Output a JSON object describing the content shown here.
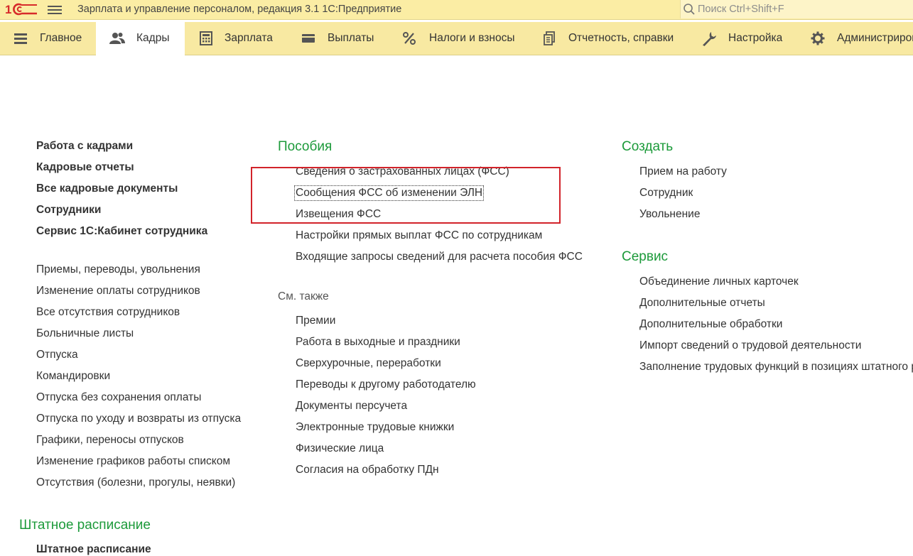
{
  "titlebar": {
    "app_title": "Зарплата и управление персоналом, редакция 3.1 1С:Предприятие",
    "search_placeholder": "Поиск Ctrl+Shift+F"
  },
  "sections": [
    {
      "label": "Главное",
      "icon": "menu-lines-icon"
    },
    {
      "label": "Кадры",
      "icon": "people-icon",
      "active": true
    },
    {
      "label": "Зарплата",
      "icon": "calculator-icon"
    },
    {
      "label": "Выплаты",
      "icon": "wallet-icon"
    },
    {
      "label": "Налоги и взносы",
      "icon": "percent-icon"
    },
    {
      "label": "Отчетность, справки",
      "icon": "documents-icon"
    },
    {
      "label": "Настройка",
      "icon": "wrench-icon"
    },
    {
      "label": "Администрирование",
      "icon": "gear-icon"
    }
  ],
  "left_column": {
    "main_links": [
      "Работа с кадрами",
      "Кадровые отчеты",
      "Все кадровые документы",
      "Сотрудники",
      "Сервис 1С:Кабинет сотрудника"
    ],
    "links": [
      "Приемы, переводы, увольнения",
      "Изменение оплаты сотрудников",
      "Все отсутствия сотрудников",
      "Больничные листы",
      "Отпуска",
      "Командировки",
      "Отпуска без сохранения оплаты",
      "Отпуска по уходу и возвраты из отпуска",
      "Графики, переносы отпусков",
      "Изменение графиков работы списком",
      "Отсутствия (болезни, прогулы, неявки)"
    ],
    "staffing_title": "Штатное расписание",
    "staffing_links": [
      "Штатное расписание"
    ]
  },
  "middle_column": {
    "benefits_title": "Пособия",
    "benefits_links": [
      "Сведения о застрахованных лицах (ФСС)",
      "Сообщения ФСС об изменении ЭЛН",
      "Извещения ФСС",
      "Настройки прямых выплат ФСС по сотрудникам",
      "Входящие запросы сведений для расчета пособия ФСС"
    ],
    "see_also_title": "См. также",
    "see_also_links": [
      "Премии",
      "Работа в выходные и праздники",
      "Сверхурочные, переработки",
      "Переводы к другому работодателю",
      "Документы персучета",
      "Электронные трудовые книжки",
      "Физические лица",
      "Согласия на обработку ПДн"
    ]
  },
  "right_column": {
    "create_title": "Создать",
    "create_links": [
      "Прием на работу",
      "Сотрудник",
      "Увольнение"
    ],
    "service_title": "Сервис",
    "service_links": [
      "Объединение личных карточек",
      "Дополнительные отчеты",
      "Дополнительные обработки",
      "Импорт сведений о трудовой деятельности",
      "Заполнение трудовых функций в позициях штатного р"
    ]
  },
  "colors": {
    "titlebar_bg": "#fbeda4",
    "tabsbar_bg": "#f8e9a2",
    "group_title": "#1c9a3a",
    "highlight_box": "#d2232a"
  }
}
